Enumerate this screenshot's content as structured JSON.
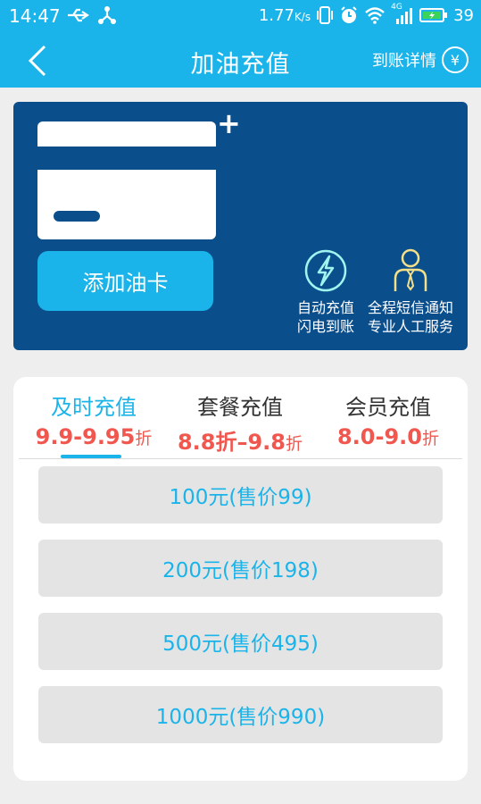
{
  "status_bar": {
    "time": "14:47",
    "net_speed": "1.77",
    "net_unit": "K/s",
    "network_label": "4G",
    "battery": "39"
  },
  "app_bar": {
    "title": "加油充值",
    "details_label": "到账详情",
    "details_icon": "yen-icon"
  },
  "card_panel": {
    "add_card_label": "添加油卡",
    "features": [
      {
        "icon": "lightning-icon",
        "line1": "自动充值",
        "line2": "闪电到账"
      },
      {
        "icon": "service-person-icon",
        "line1": "全程短信通知",
        "line2": "专业人工服务"
      }
    ]
  },
  "tabs": [
    {
      "label": "及时充值",
      "discount": "9.9-9.95",
      "unit": "折",
      "active": true
    },
    {
      "label": "套餐充值",
      "discount": "8.8折–9.8",
      "unit": "折",
      "active": false
    },
    {
      "label": "会员充值",
      "discount": "8.0-9.0",
      "unit": "折",
      "active": false
    }
  ],
  "options": [
    {
      "label": "100元(售价99)"
    },
    {
      "label": "200元(售价198)"
    },
    {
      "label": "500元(售价495)"
    },
    {
      "label": "1000元(售价990)"
    }
  ],
  "colors": {
    "accent": "#1ab4ea",
    "panel_dark": "#0b4e8c",
    "discount_red": "#f0584f",
    "option_bg": "#e4e4e4"
  }
}
